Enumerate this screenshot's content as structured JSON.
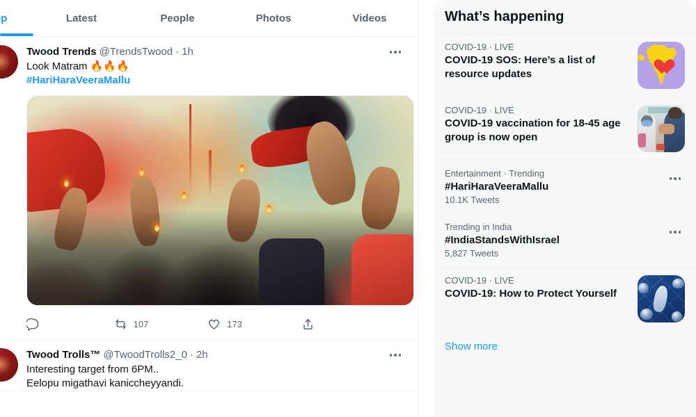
{
  "tabs": [
    {
      "label": "Top",
      "active": true
    },
    {
      "label": "Latest",
      "active": false
    },
    {
      "label": "People",
      "active": false
    },
    {
      "label": "Photos",
      "active": false
    },
    {
      "label": "Videos",
      "active": false
    }
  ],
  "tweets": [
    {
      "display_name": "Twood Trends",
      "handle": "@TrendsTwood",
      "separator": "·",
      "time": "1h",
      "text_line1": "Look Matram 🔥🔥🔥",
      "hashtag": "#HariHaraVeeraMallu",
      "more_icon": "more-horizontal-icon",
      "actions": {
        "reply_icon": "reply-icon",
        "reply_count": "",
        "retweet_icon": "retweet-icon",
        "retweet_count": "107",
        "like_icon": "heart-icon",
        "like_count": "173",
        "share_icon": "share-icon"
      }
    },
    {
      "display_name": "Twood Trolls™",
      "handle": "@TwoodTrolls2_0",
      "separator": "·",
      "time": "2h",
      "text_line1": "Interesting target from 6PM..",
      "text_line2": "Eelopu migathavi kaniccheyyandi.",
      "more_icon": "more-horizontal-icon"
    }
  ],
  "sidebar": {
    "title": "What’s happening",
    "show_more": "Show more",
    "items": [
      {
        "meta": "COVID-19 · LIVE",
        "title": "COVID-19 SOS: Here’s a list of resource updates",
        "count": "",
        "thumb": "india-heart-thumb",
        "has_dots": false
      },
      {
        "meta": "COVID-19 · LIVE",
        "title": "COVID-19 vaccination for 18-45 age group is now open",
        "count": "",
        "thumb": "vaccination-photo-thumb",
        "has_dots": false
      },
      {
        "meta": "Entertainment · Trending",
        "title": "#HariHaraVeeraMallu",
        "count": "10.1K Tweets",
        "thumb": "",
        "has_dots": true
      },
      {
        "meta": "Trending in India",
        "title": "#IndiaStandsWithIsrael",
        "count": "5,827 Tweets",
        "thumb": "",
        "has_dots": true
      },
      {
        "meta": "COVID-19 · LIVE",
        "title": "COVID-19: How to Protect Yourself",
        "count": "",
        "thumb": "handwashing-photo-thumb",
        "has_dots": false
      }
    ]
  },
  "colors": {
    "accent": "#1d9bf0",
    "text": "#0f1419",
    "muted": "#536471",
    "border": "#eff3f4",
    "sidebar_bg": "#f7f9f9"
  }
}
